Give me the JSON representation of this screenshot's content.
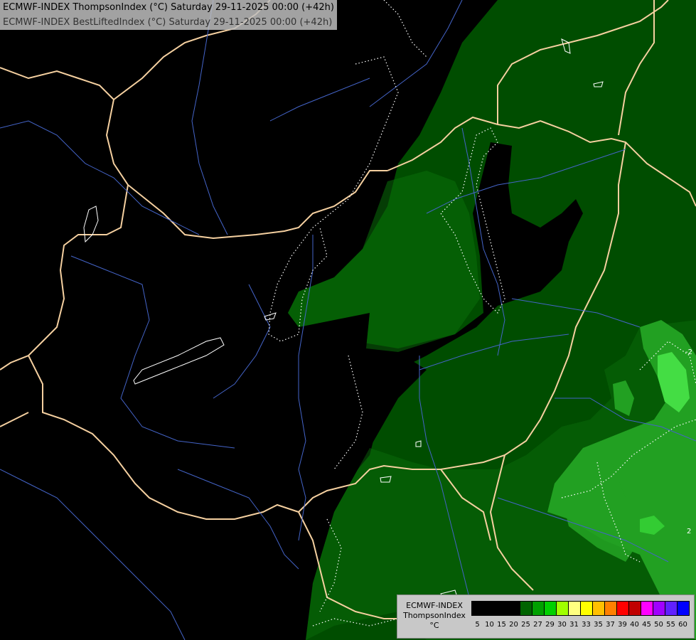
{
  "title": {
    "line1": "ECMWF-INDEX ThompsonIndex (°C) Saturday 29-11-2025 00:00 (+42h)",
    "line2": "ECMWF-INDEX BestLiftedIndex (°C) Saturday 29-11-2025 00:00 (+42h)"
  },
  "legend": {
    "label_line1": "ECMWF-INDEX",
    "label_line2": "ThompsonIndex",
    "label_line3": "°C",
    "ticks": [
      "5",
      "10",
      "15",
      "20",
      "25",
      "27",
      "29",
      "30",
      "31",
      "33",
      "35",
      "37",
      "39",
      "40",
      "45",
      "50",
      "55",
      "60"
    ],
    "colors": [
      "#000000",
      "#000000",
      "#000000",
      "#000000",
      "#006400",
      "#00a000",
      "#00d000",
      "#a0ff00",
      "#ffff80",
      "#ffff00",
      "#ffc000",
      "#ff8000",
      "#ff0000",
      "#c00000",
      "#ff00ff",
      "#a000ff",
      "#6020ff",
      "#0000ff"
    ]
  },
  "map_colors": {
    "background": "#000000",
    "green_dark": "#004d00",
    "green_mid": "#0a7a0a",
    "green_light": "#22b022",
    "green_bright": "#55ff55",
    "borders": "#f5d0a0",
    "rivers": "#4060c0",
    "contours": "#ffffff"
  }
}
